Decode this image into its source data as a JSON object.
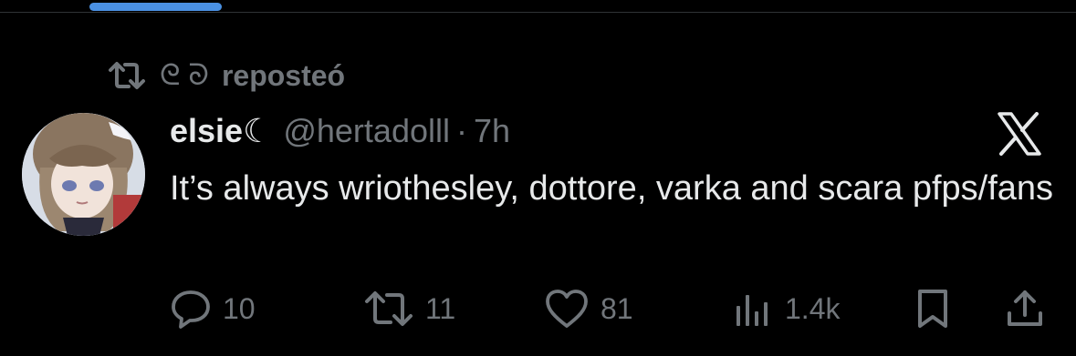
{
  "tab": {
    "indicator_color": "#4a90e2"
  },
  "repost": {
    "icon": "repost-icon",
    "reposter_name": "ᘓ ᘐ",
    "action_text": "reposteó"
  },
  "tweet": {
    "avatar_icon": "avatar",
    "display_name": "elsie☾",
    "handle": "@hertadolll",
    "separator": "·",
    "time": "7h",
    "brand_icon": "x-logo-icon",
    "text": "It’s always wriothesley, dottore, varka and scara pfps/fans"
  },
  "actions": {
    "reply": {
      "icon": "reply-icon",
      "count": "10"
    },
    "repost": {
      "icon": "repost-icon",
      "count": "11"
    },
    "like": {
      "icon": "heart-icon",
      "count": "81"
    },
    "views": {
      "icon": "views-icon",
      "count": "1.4k"
    },
    "bookmark": {
      "icon": "bookmark-icon"
    },
    "share": {
      "icon": "share-icon"
    }
  },
  "colors": {
    "background": "#000000",
    "primary_text": "#e7e9ea",
    "secondary_text": "#71767b",
    "divider": "#2f3336"
  }
}
